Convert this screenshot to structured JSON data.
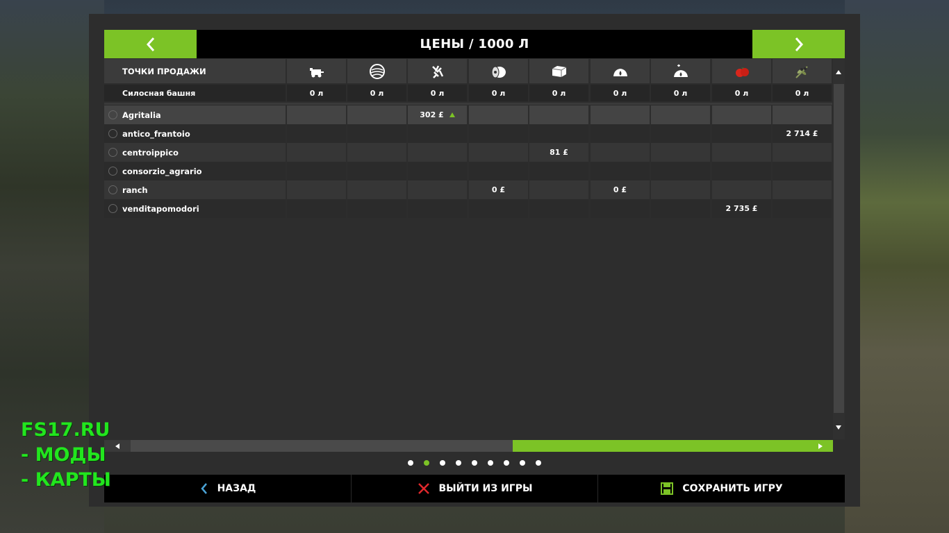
{
  "window": {
    "title": "ЦЕНЫ / 1000 Л"
  },
  "header": {
    "columns_label": "ТОЧКИ ПРОДАЖИ",
    "fill_type_icons": [
      "harvester-icon",
      "wool-icon",
      "wood-chips-icon",
      "bale-round-icon",
      "bale-square-icon",
      "seeds-icon",
      "fertilizer-icon",
      "tomato-icon",
      "olive-branch-icon"
    ]
  },
  "silo": {
    "label": "Силосная башня",
    "values": [
      "0 л",
      "0 л",
      "0 л",
      "0 л",
      "0 л",
      "0 л",
      "0 л",
      "0 л",
      "0 л"
    ]
  },
  "rows": [
    {
      "name": "Agritalia",
      "cells": [
        "",
        "",
        "302 £",
        "",
        "",
        "",
        "",
        "",
        ""
      ],
      "trend_up_col": 2
    },
    {
      "name": "antico_frantoio",
      "cells": [
        "",
        "",
        "",
        "",
        "",
        "",
        "",
        "",
        "2 714 £"
      ]
    },
    {
      "name": "centroippico",
      "cells": [
        "",
        "",
        "",
        "",
        "81 £",
        "",
        "",
        "",
        ""
      ]
    },
    {
      "name": "consorzio_agrario",
      "cells": [
        "",
        "",
        "",
        "",
        "",
        "",
        "",
        "",
        ""
      ]
    },
    {
      "name": "ranch",
      "cells": [
        "",
        "",
        "",
        "0 £",
        "",
        "0 £",
        "",
        "",
        ""
      ]
    },
    {
      "name": "venditapomodori",
      "cells": [
        "",
        "",
        "",
        "",
        "",
        "",
        "",
        "2 735 £",
        ""
      ]
    }
  ],
  "pagination": {
    "count": 9,
    "active_index": 1
  },
  "footer": {
    "back_label": "НАЗАД",
    "quit_label": "ВЫЙТИ ИЗ ИГРЫ",
    "save_label": "СОХРАНИТЬ ИГРУ"
  },
  "watermark": {
    "line1": "FS17.RU",
    "line2": "- МОДЫ",
    "line3": "- КАРТЫ"
  },
  "colors": {
    "accent": "#7cc326",
    "quit_icon": "#e0282c",
    "back_icon": "#4aa3d6",
    "watermark": "#22e61e"
  }
}
